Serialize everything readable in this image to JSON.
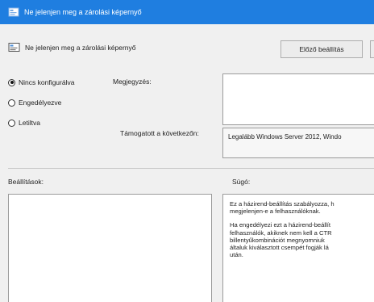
{
  "window": {
    "title": "Ne jelenjen meg a zárolási képernyő",
    "accent": "#1f7ee0"
  },
  "header": {
    "policy_name": "Ne jelenjen meg a zárolási képernyő",
    "icon": "policy-setting-icon"
  },
  "buttons": {
    "previous_setting": "Előző beállítás",
    "next_setting": ""
  },
  "state_options": [
    {
      "label": "Nincs konfigurálva",
      "selected": true
    },
    {
      "label": "Engedélyezve",
      "selected": false
    },
    {
      "label": "Letiltva",
      "selected": false
    }
  ],
  "fields": {
    "comment_label": "Megjegyzés:",
    "comment_value": "",
    "supported_label": "Támogatott a következőn:",
    "supported_value": "Legalább Windows Server 2012, Windo"
  },
  "sections": {
    "options_label": "Beállítások:",
    "help_label": "Súgó:"
  },
  "help": {
    "paragraphs": [
      [
        "Ez a házirend-beállítás szabályozza, h",
        "megjelenjen-e a felhasználóknak."
      ],
      [
        "Ha engedélyezi ezt a házirend-beállít",
        "felhasználók, akiknek nem kell a CTR",
        "billentyűkombinációt megnyomniuk",
        "általuk kiválasztott csempét fogják lá",
        "után."
      ]
    ]
  }
}
